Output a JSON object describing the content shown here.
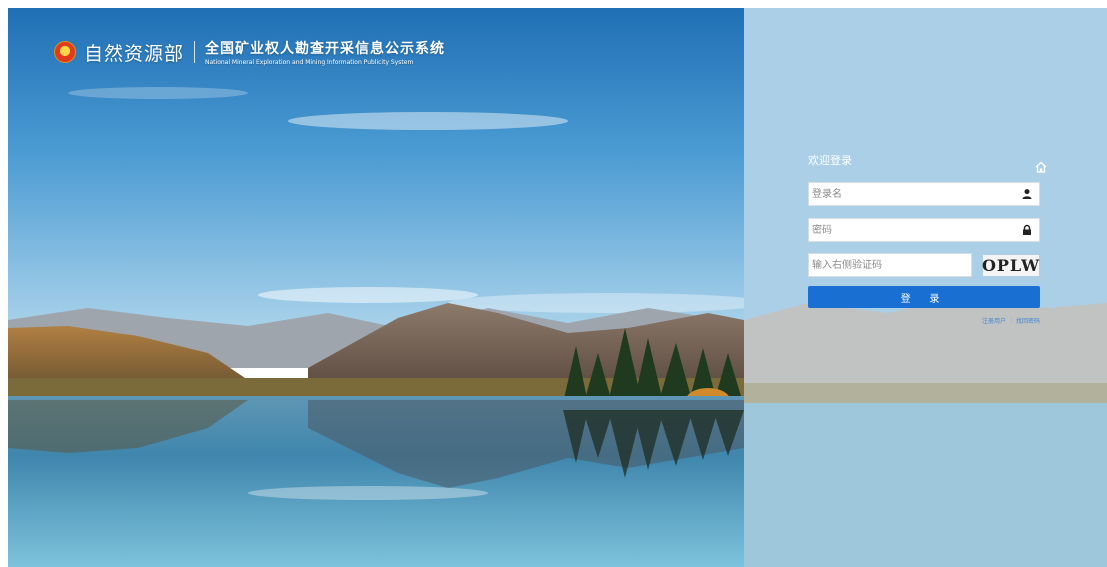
{
  "header": {
    "ministry_name": "自然资源部",
    "system_title": "全国矿业权人勘查开采信息公示系统",
    "system_subtitle": "National Mineral Exploration and Mining Information Publicity System"
  },
  "login": {
    "welcome": "欢迎登录",
    "username_placeholder": "登录名",
    "password_placeholder": "密码",
    "captcha_placeholder": "输入右侧验证码",
    "captcha_text": "OPLW",
    "submit_label": "登 录",
    "register_link": "注册用户",
    "forgot_link": "找回密码",
    "links_separator": "|"
  },
  "icons": {
    "emblem": "national-emblem-icon",
    "home": "home-icon",
    "user": "user-icon",
    "lock": "lock-icon"
  },
  "colors": {
    "button": "#1a6fd3",
    "link": "#3f86d6"
  }
}
